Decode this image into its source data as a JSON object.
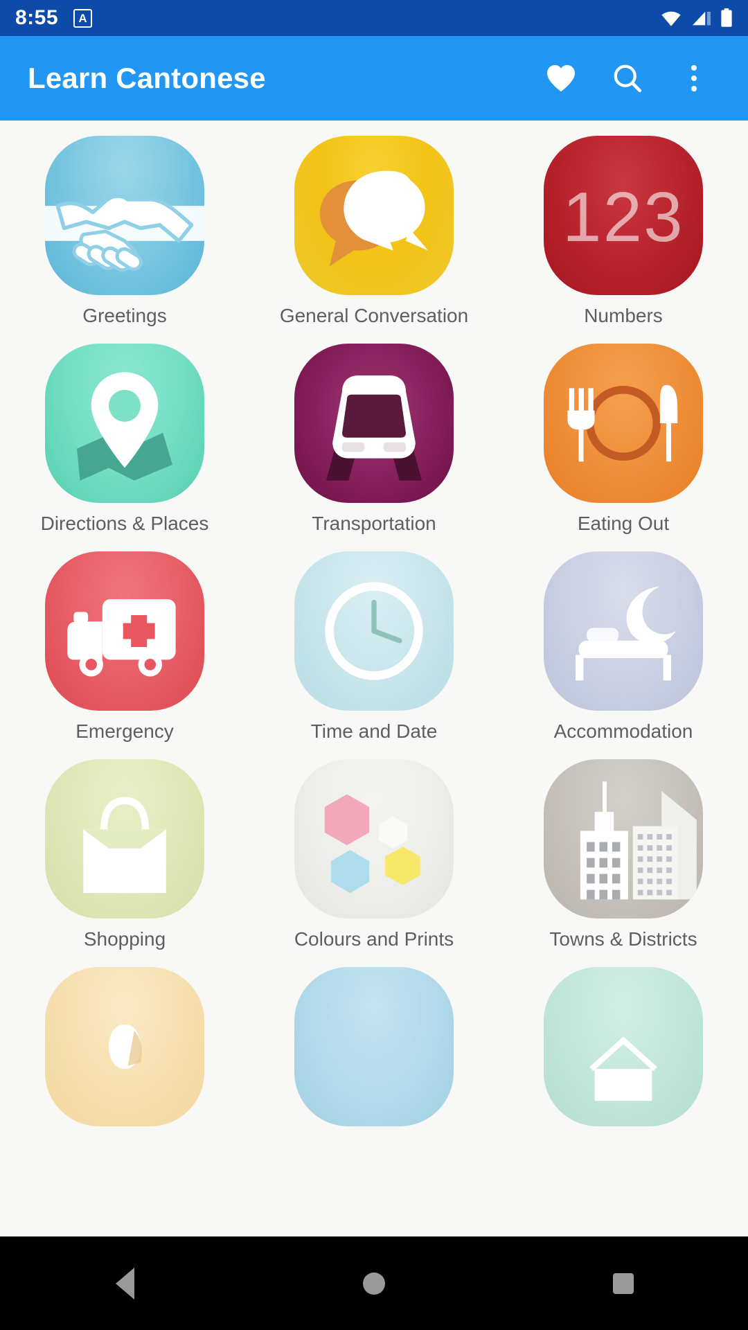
{
  "status_bar": {
    "time": "8:55",
    "app_badge_letter": "A",
    "icons": [
      "wifi-icon",
      "cellular-signal-icon",
      "battery-icon"
    ],
    "background_color": "#0E4BA8"
  },
  "app_bar": {
    "title": "Learn Cantonese",
    "background_color": "#2196F3",
    "actions": [
      {
        "name": "favorites-button",
        "icon": "heart-icon"
      },
      {
        "name": "search-button",
        "icon": "search-icon"
      },
      {
        "name": "overflow-menu-button",
        "icon": "more-vertical-icon"
      }
    ]
  },
  "grid": {
    "tiles": [
      {
        "label": "Greetings",
        "icon": "handshake-icon",
        "color_from": "#8ED0E8",
        "color_to": "#5BB8D8"
      },
      {
        "label": "General Conversation",
        "icon": "speech-bubbles-icon",
        "color_from": "#F5C518",
        "color_to": "#EFC92A"
      },
      {
        "label": "Numbers",
        "icon": "123-icon",
        "color_from": "#B3212C",
        "color_to": "#C8323C"
      },
      {
        "label": "Directions & Places",
        "icon": "map-pin-icon",
        "color_from": "#7EE0C8",
        "color_to": "#62D9BC"
      },
      {
        "label": "Transportation",
        "icon": "train-icon",
        "color_from": "#7B1450",
        "color_to": "#9E2E69"
      },
      {
        "label": "Eating Out",
        "icon": "cutlery-plate-icon",
        "color_from": "#F0953F",
        "color_to": "#ED8B33"
      },
      {
        "label": "Emergency",
        "icon": "ambulance-icon",
        "color_from": "#E8636A",
        "color_to": "#E05A61"
      },
      {
        "label": "Time and Date",
        "icon": "clock-icon",
        "color_from": "#CFE8EE",
        "color_to": "#BFE0E8"
      },
      {
        "label": "Accommodation",
        "icon": "bed-moon-icon",
        "color_from": "#CFD4E6",
        "color_to": "#C2C8DE"
      },
      {
        "label": "Shopping",
        "icon": "shopping-bag-icon",
        "color_from": "#E0E8BC",
        "color_to": "#DAE4B0"
      },
      {
        "label": "Colours and Prints",
        "icon": "hexagons-icon",
        "color_from": "#F0F0EE",
        "color_to": "#EAEAE6"
      },
      {
        "label": "Towns & Districts",
        "icon": "cityscape-icon",
        "color_from": "#C9C6BF",
        "color_to": "#BFBCB4"
      }
    ],
    "partial_row_tiles": [
      {
        "label": "",
        "icon": "partial-tile-icon",
        "color_from": "#F7E2B8",
        "color_to": "#F5DCA8"
      },
      {
        "label": "",
        "icon": "partial-tile-icon",
        "color_from": "#B5DCEA",
        "color_to": "#A8D4E6"
      },
      {
        "label": "",
        "icon": "partial-tile-icon",
        "color_from": "#C5E8DE",
        "color_to": "#B8E2D6"
      }
    ]
  },
  "nav_bar": {
    "background_color": "#000000",
    "buttons": [
      {
        "name": "nav-back-button",
        "icon": "triangle-back-icon"
      },
      {
        "name": "nav-home-button",
        "icon": "circle-home-icon"
      },
      {
        "name": "nav-recents-button",
        "icon": "square-recents-icon"
      }
    ]
  }
}
